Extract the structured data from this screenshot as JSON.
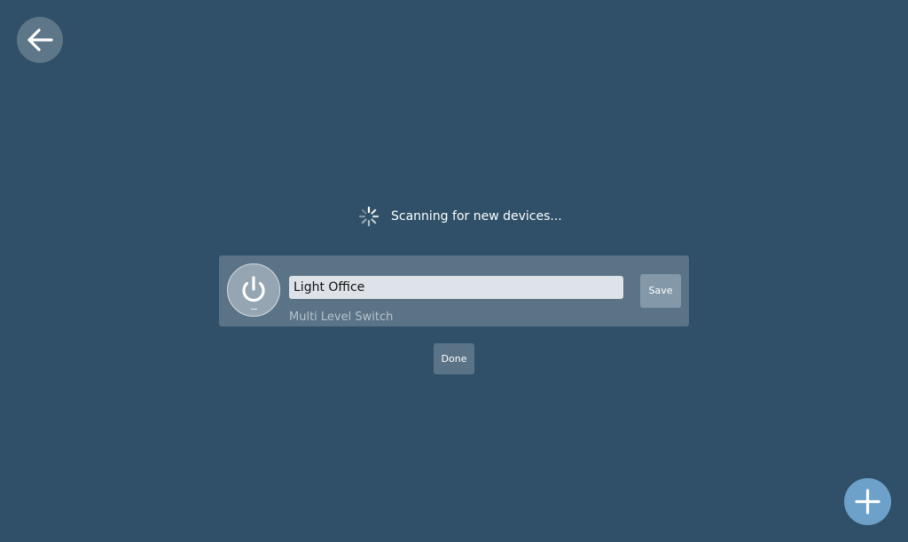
{
  "navigation": {
    "back_icon": "arrow-left-icon"
  },
  "scanning": {
    "icon": "spinner-icon",
    "text": "Scanning for new devices..."
  },
  "device": {
    "icon": "power-icon",
    "name_value": "Light Office",
    "type": "Multi Level Switch",
    "save_label": "Save"
  },
  "actions": {
    "done_label": "Done",
    "add_icon": "plus-icon"
  },
  "colors": {
    "background": "#2f5068",
    "card": "#5b7387",
    "accent": "#6ea1c9"
  }
}
